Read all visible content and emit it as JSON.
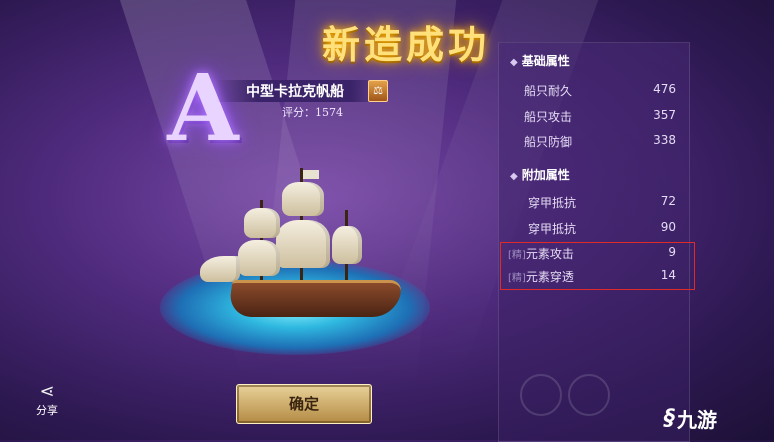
{
  "title": "新造成功",
  "ship": {
    "grade": "A",
    "name": "中型卡拉克帆船",
    "badge_icon": "scales-icon",
    "score": "评分：1574"
  },
  "panel": {
    "base_section": {
      "title": "基础属性",
      "rows": [
        {
          "label": "船只耐久",
          "value": "476"
        },
        {
          "label": "船只攻击",
          "value": "357"
        },
        {
          "label": "船只防御",
          "value": "338"
        }
      ]
    },
    "extra_section": {
      "title": "附加属性",
      "rows": [
        {
          "label": "穿甲抵抗",
          "value": "72"
        },
        {
          "label": "穿甲抵抗",
          "value": "90"
        },
        {
          "tag": "[精]",
          "label": "元素攻击",
          "value": "9"
        },
        {
          "tag": "[精]",
          "label": "元素穿透",
          "value": "14"
        }
      ]
    }
  },
  "buttons": {
    "confirm": "确定",
    "share": "分享"
  },
  "watermark": {
    "brand": "九游"
  },
  "colors": {
    "title_gold": "#ffe07a",
    "highlight_red": "#e02a2a",
    "button_gold": "#e9d29a"
  }
}
